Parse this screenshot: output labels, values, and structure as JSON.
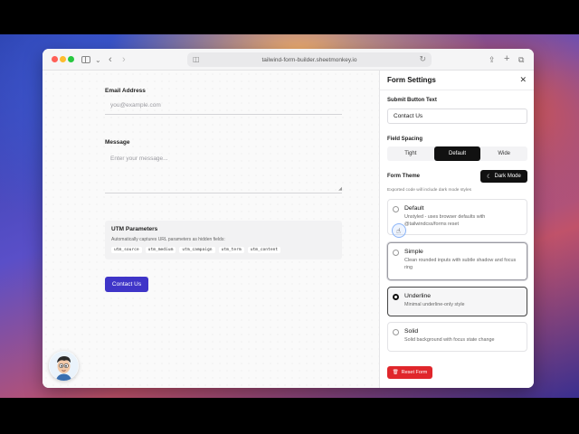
{
  "browser": {
    "url": "tailwind-form-builder.sheetmonkey.io"
  },
  "form": {
    "email_label": "Email Address",
    "email_placeholder": "you@example.com",
    "message_label": "Message",
    "message_placeholder": "Enter your message...",
    "utm": {
      "title": "UTM Parameters",
      "description": "Automatically captures URL parameters as hidden fields:",
      "tags": [
        "utm_source",
        "utm_medium",
        "utm_campaign",
        "utm_term",
        "utm_content"
      ]
    },
    "submit_label": "Contact Us"
  },
  "panel": {
    "title": "Form Settings",
    "submit_text_label": "Submit Button Text",
    "submit_text_value": "Contact Us",
    "spacing_label": "Field Spacing",
    "spacing_options": [
      "Tight",
      "Default",
      "Wide"
    ],
    "spacing_selected": "Default",
    "theme_label": "Form Theme",
    "dark_mode_label": "Dark Mode",
    "theme_note": "Exported code will include dark mode styles",
    "themes": [
      {
        "name": "Default",
        "desc": "Unstyled - uses browser defaults with @tailwindcss/forms reset"
      },
      {
        "name": "Simple",
        "desc": "Clean rounded inputs with subtle shadow and focus ring"
      },
      {
        "name": "Underline",
        "desc": "Minimal underline-only style"
      },
      {
        "name": "Solid",
        "desc": "Solid background with focus state change"
      }
    ],
    "theme_selected": "Underline",
    "reset_label": "Reset Form"
  },
  "colors": {
    "primary": "#3f35c8",
    "danger": "#e0262b",
    "dark": "#111111"
  }
}
